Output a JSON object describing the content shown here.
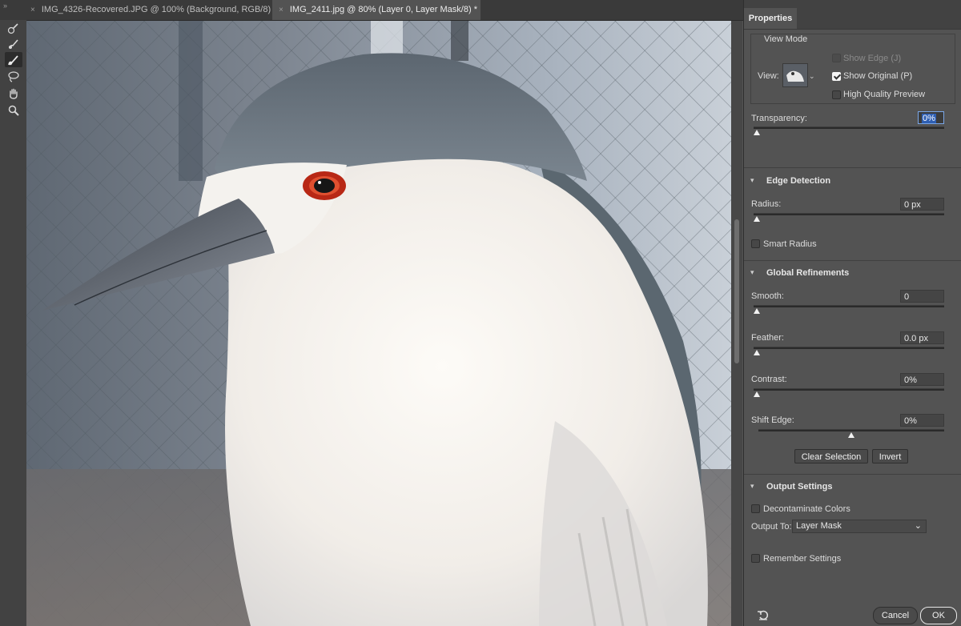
{
  "tabs": [
    {
      "close": "×",
      "title": "IMG_4326-Recovered.JPG @ 100% (Background, RGB/8) *"
    },
    {
      "close": "×",
      "title": "IMG_2411.jpg @ 80% (Layer 0, Layer Mask/8) *"
    }
  ],
  "collapse_glyph": "»",
  "toolbar": {
    "tools": [
      {
        "icon": "quick-selection-brush-icon",
        "active": false
      },
      {
        "icon": "refine-edge-brush-icon",
        "active": false
      },
      {
        "icon": "brush-icon",
        "active": true
      },
      {
        "icon": "lasso-icon",
        "active": false
      },
      {
        "icon": "hand-icon",
        "active": false
      },
      {
        "icon": "zoom-icon",
        "active": false
      }
    ]
  },
  "panel": {
    "title": "Properties",
    "view_mode": {
      "heading": "View Mode",
      "view_label": "View:",
      "show_edge": {
        "label": "Show Edge (J)",
        "checked": false,
        "enabled": false
      },
      "show_original": {
        "label": "Show Original (P)",
        "checked": true
      },
      "high_quality": {
        "label": "High Quality Preview",
        "checked": false
      },
      "transparency_label": "Transparency:",
      "transparency_value": "0%",
      "transparency_level": 0
    },
    "edge_detection": {
      "title": "Edge Detection",
      "radius_label": "Radius:",
      "radius_value": "0 px",
      "smart_radius": {
        "label": "Smart Radius",
        "checked": false
      }
    },
    "global_refinements": {
      "title": "Global Refinements",
      "smooth_label": "Smooth:",
      "smooth_value": "0",
      "feather_label": "Feather:",
      "feather_value": "0.0 px",
      "contrast_label": "Contrast:",
      "contrast_value": "0%",
      "shift_edge_label": "Shift Edge:",
      "shift_edge_value": "0%",
      "clear_selection": "Clear Selection",
      "invert": "Invert"
    },
    "output_settings": {
      "title": "Output Settings",
      "decontaminate": {
        "label": "Decontaminate Colors",
        "checked": false
      },
      "output_to_label": "Output To:",
      "output_to_value": "Layer Mask",
      "remember": {
        "label": "Remember Settings",
        "checked": false
      }
    },
    "footer": {
      "reset_icon": "reset-icon",
      "cancel": "Cancel",
      "ok": "OK"
    }
  },
  "colors": {
    "panel_bg": "#535353",
    "toolbar_bg": "#424242",
    "focus_blue": "#2f5fb3"
  }
}
